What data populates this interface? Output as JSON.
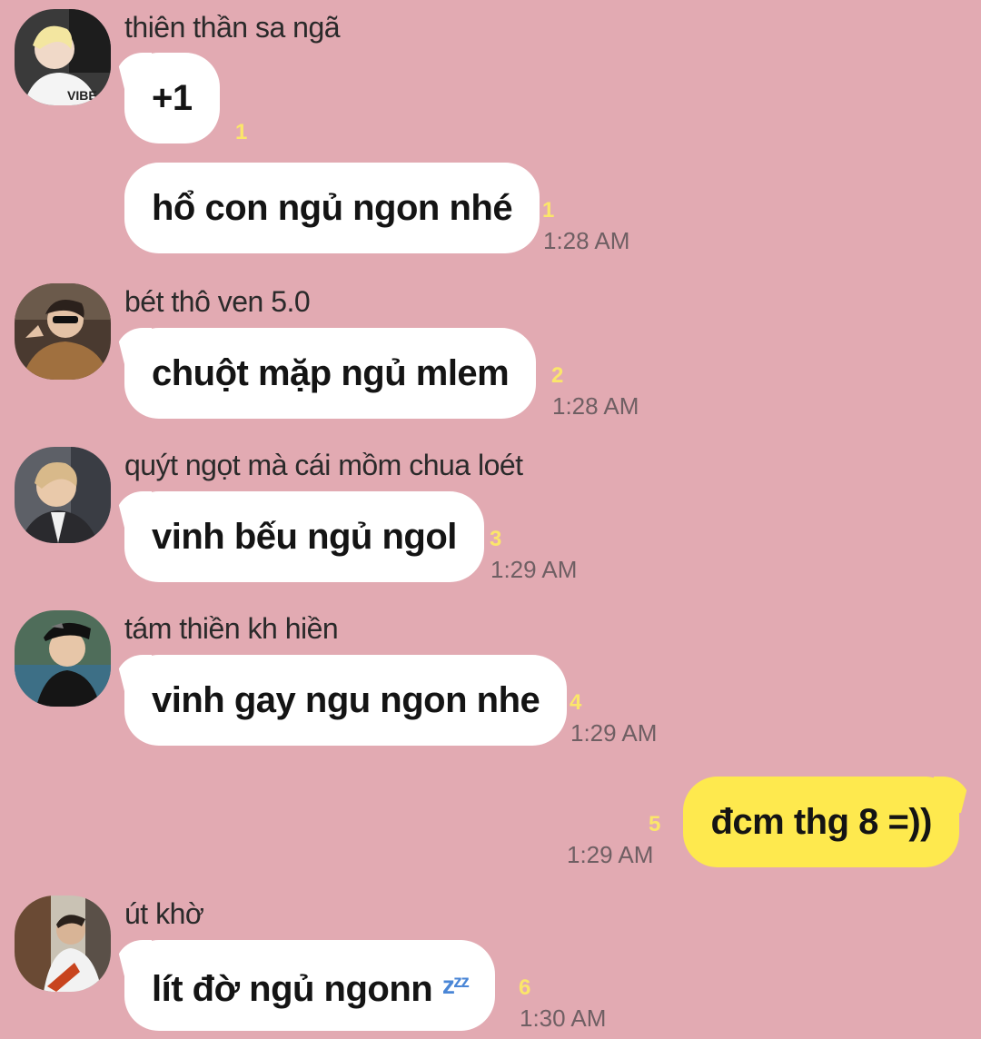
{
  "colors": {
    "background": "#e2aab2",
    "bubble_incoming": "#ffffff",
    "bubble_outgoing": "#fee94e",
    "unread_count": "#fbe66a",
    "timestamp": "#6f5f63"
  },
  "messages": [
    {
      "sender": "thiên thần sa ngã",
      "avatar_icon": "profile-photo-icon",
      "bubbles": [
        {
          "text": "+1",
          "unread": "1",
          "time": ""
        },
        {
          "text": "hổ con ngủ ngon nhé",
          "unread": "1",
          "time": "1:28 AM"
        }
      ]
    },
    {
      "sender": "bét thô ven 5.0",
      "avatar_icon": "profile-photo-icon",
      "bubbles": [
        {
          "text": "chuột mặp ngủ mlem",
          "unread": "2",
          "time": "1:28 AM"
        }
      ]
    },
    {
      "sender": "quýt ngọt mà cái mồm chua loét",
      "avatar_icon": "profile-photo-icon",
      "bubbles": [
        {
          "text": "vinh bếu ngủ ngol",
          "unread": "3",
          "time": "1:29 AM"
        }
      ]
    },
    {
      "sender": "tám thiền kh hiền",
      "avatar_icon": "profile-photo-icon",
      "bubbles": [
        {
          "text": "vinh gay ngu ngon nhe",
          "unread": "4",
          "time": "1:29 AM"
        }
      ]
    },
    {
      "sender": "me",
      "bubbles": [
        {
          "text": "đcm thg 8 =))",
          "unread": "5",
          "time": "1:29 AM"
        }
      ]
    },
    {
      "sender": "út khờ",
      "avatar_icon": "profile-photo-icon",
      "bubbles": [
        {
          "text": "lít đờ ngủ ngonn",
          "emoji": "zᶻᶻ",
          "unread": "6",
          "time": "1:30 AM"
        }
      ]
    }
  ]
}
